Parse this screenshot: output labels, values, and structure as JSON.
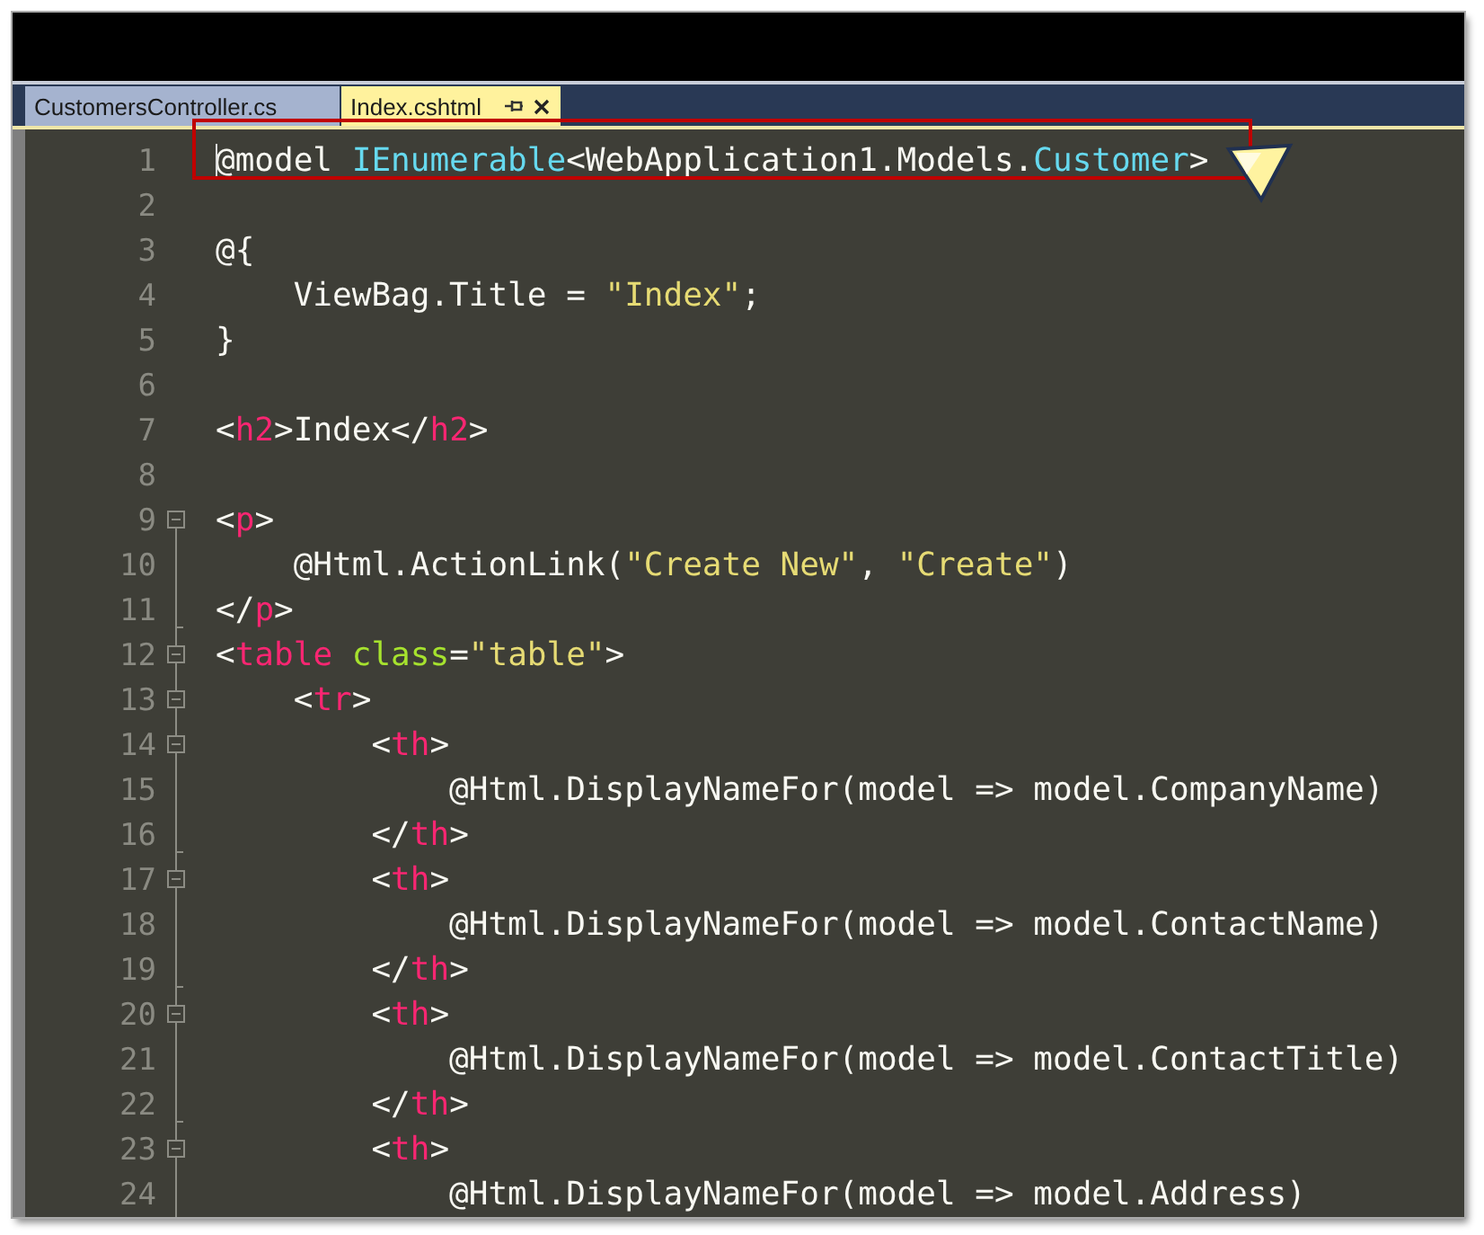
{
  "tabs": [
    {
      "label": "CustomersController.cs",
      "selected": false
    },
    {
      "label": "Index.cshtml",
      "selected": true,
      "pinned": true,
      "closable": true
    }
  ],
  "editor": {
    "lines": [
      {
        "number": "1",
        "kind": "plain",
        "highlighted": true,
        "caret": true,
        "tokens": [
          {
            "text": "@model ",
            "kind": "plain"
          },
          {
            "text": "IEnumerable",
            "kind": "type"
          },
          {
            "text": "<WebApplication1.Models.",
            "kind": "plain"
          },
          {
            "text": "Customer",
            "kind": "type"
          },
          {
            "text": ">",
            "kind": "plain"
          }
        ]
      },
      {
        "number": "2",
        "kind": "plain"
      },
      {
        "number": "3",
        "kind": "plain",
        "tokens": [
          {
            "text": "@{",
            "kind": "plain"
          }
        ]
      },
      {
        "number": "4",
        "kind": "plain",
        "tokens": [
          {
            "text": "    ViewBag.Title = ",
            "kind": "plain"
          },
          {
            "text": "\"Index\"",
            "kind": "string"
          },
          {
            "text": ";",
            "kind": "plain"
          }
        ]
      },
      {
        "number": "5",
        "kind": "plain",
        "tokens": [
          {
            "text": "}",
            "kind": "plain"
          }
        ]
      },
      {
        "number": "6",
        "kind": "plain"
      },
      {
        "number": "7",
        "kind": "plain",
        "tokens": [
          {
            "text": "<",
            "kind": "plain"
          },
          {
            "text": "h2",
            "kind": "tag"
          },
          {
            "text": ">Index</",
            "kind": "plain"
          },
          {
            "text": "h2",
            "kind": "tag"
          },
          {
            "text": ">",
            "kind": "plain"
          }
        ]
      },
      {
        "number": "8",
        "kind": "plain"
      },
      {
        "number": "9",
        "kind": "fold-start",
        "tokens": [
          {
            "text": "<",
            "kind": "plain"
          },
          {
            "text": "p",
            "kind": "tag"
          },
          {
            "text": ">",
            "kind": "plain"
          }
        ]
      },
      {
        "number": "10",
        "kind": "fold-line",
        "tokens": [
          {
            "text": "    @Html.ActionLink(",
            "kind": "plain"
          },
          {
            "text": "\"Create New\"",
            "kind": "string"
          },
          {
            "text": ", ",
            "kind": "plain"
          },
          {
            "text": "\"Create\"",
            "kind": "string"
          },
          {
            "text": ")",
            "kind": "plain"
          }
        ]
      },
      {
        "number": "11",
        "kind": "fold-end",
        "tokens": [
          {
            "text": "</",
            "kind": "plain"
          },
          {
            "text": "p",
            "kind": "tag"
          },
          {
            "text": ">",
            "kind": "plain"
          }
        ]
      },
      {
        "number": "12",
        "kind": "fold-start",
        "tokens": [
          {
            "text": "<",
            "kind": "plain"
          },
          {
            "text": "table",
            "kind": "tag"
          },
          {
            "text": " class",
            "kind": "attr"
          },
          {
            "text": "=",
            "kind": "plain"
          },
          {
            "text": "\"table\"",
            "kind": "string"
          },
          {
            "text": ">",
            "kind": "plain"
          }
        ]
      },
      {
        "number": "13",
        "kind": "fold-start",
        "tokens": [
          {
            "text": "    <",
            "kind": "plain"
          },
          {
            "text": "tr",
            "kind": "tag"
          },
          {
            "text": ">",
            "kind": "plain"
          }
        ]
      },
      {
        "number": "14",
        "kind": "fold-start",
        "tokens": [
          {
            "text": "        <",
            "kind": "plain"
          },
          {
            "text": "th",
            "kind": "tag"
          },
          {
            "text": ">",
            "kind": "plain"
          }
        ]
      },
      {
        "number": "15",
        "kind": "fold-line",
        "tokens": [
          {
            "text": "            @Html.DisplayNameFor(model => model.CompanyName)",
            "kind": "plain"
          }
        ]
      },
      {
        "number": "16",
        "kind": "fold-end",
        "tokens": [
          {
            "text": "        </",
            "kind": "plain"
          },
          {
            "text": "th",
            "kind": "tag"
          },
          {
            "text": ">",
            "kind": "plain"
          }
        ]
      },
      {
        "number": "17",
        "kind": "fold-start",
        "tokens": [
          {
            "text": "        <",
            "kind": "plain"
          },
          {
            "text": "th",
            "kind": "tag"
          },
          {
            "text": ">",
            "kind": "plain"
          }
        ]
      },
      {
        "number": "18",
        "kind": "fold-line",
        "tokens": [
          {
            "text": "            @Html.DisplayNameFor(model => model.ContactName)",
            "kind": "plain"
          }
        ]
      },
      {
        "number": "19",
        "kind": "fold-end",
        "tokens": [
          {
            "text": "        </",
            "kind": "plain"
          },
          {
            "text": "th",
            "kind": "tag"
          },
          {
            "text": ">",
            "kind": "plain"
          }
        ]
      },
      {
        "number": "20",
        "kind": "fold-start",
        "tokens": [
          {
            "text": "        <",
            "kind": "plain"
          },
          {
            "text": "th",
            "kind": "tag"
          },
          {
            "text": ">",
            "kind": "plain"
          }
        ]
      },
      {
        "number": "21",
        "kind": "fold-line",
        "tokens": [
          {
            "text": "            @Html.DisplayNameFor(model => model.ContactTitle)",
            "kind": "plain"
          }
        ]
      },
      {
        "number": "22",
        "kind": "fold-end",
        "tokens": [
          {
            "text": "        </",
            "kind": "plain"
          },
          {
            "text": "th",
            "kind": "tag"
          },
          {
            "text": ">",
            "kind": "plain"
          }
        ]
      },
      {
        "number": "23",
        "kind": "fold-start",
        "tokens": [
          {
            "text": "        <",
            "kind": "plain"
          },
          {
            "text": "th",
            "kind": "tag"
          },
          {
            "text": ">",
            "kind": "plain"
          }
        ]
      },
      {
        "number": "24",
        "kind": "fold-line",
        "tokens": [
          {
            "text": "            @Html.DisplayNameFor(model => model.Address)",
            "kind": "plain"
          }
        ]
      }
    ]
  }
}
